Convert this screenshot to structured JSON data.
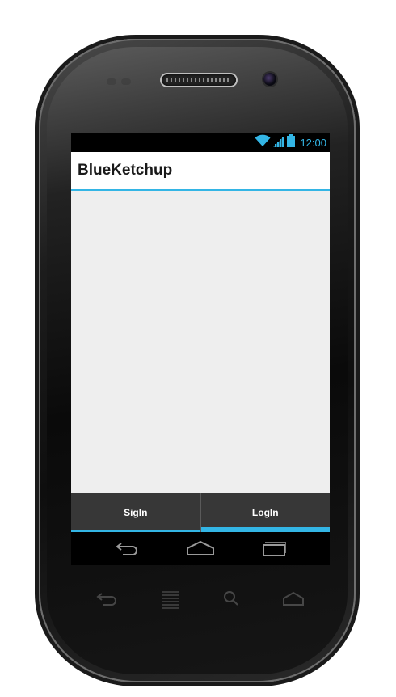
{
  "status_bar": {
    "time": "12:00",
    "icons": [
      "wifi-icon",
      "signal-icon",
      "battery-icon"
    ],
    "accent_color": "#33b5e5"
  },
  "action_bar": {
    "title": "BlueKetchup",
    "underline_color": "#33b5e5"
  },
  "tabs": [
    {
      "label": "SigIn",
      "selected": false
    },
    {
      "label": "LogIn",
      "selected": true
    }
  ],
  "nav_bar": {
    "icons": [
      "back-icon",
      "home-icon",
      "recent-apps-icon"
    ]
  },
  "hardware_keys": {
    "icons": [
      "back-icon",
      "menu-icon",
      "search-icon",
      "home-icon"
    ]
  },
  "colors": {
    "content_background": "#eeeeee",
    "tab_bar_background": "#373737",
    "accent": "#33b5e5"
  }
}
